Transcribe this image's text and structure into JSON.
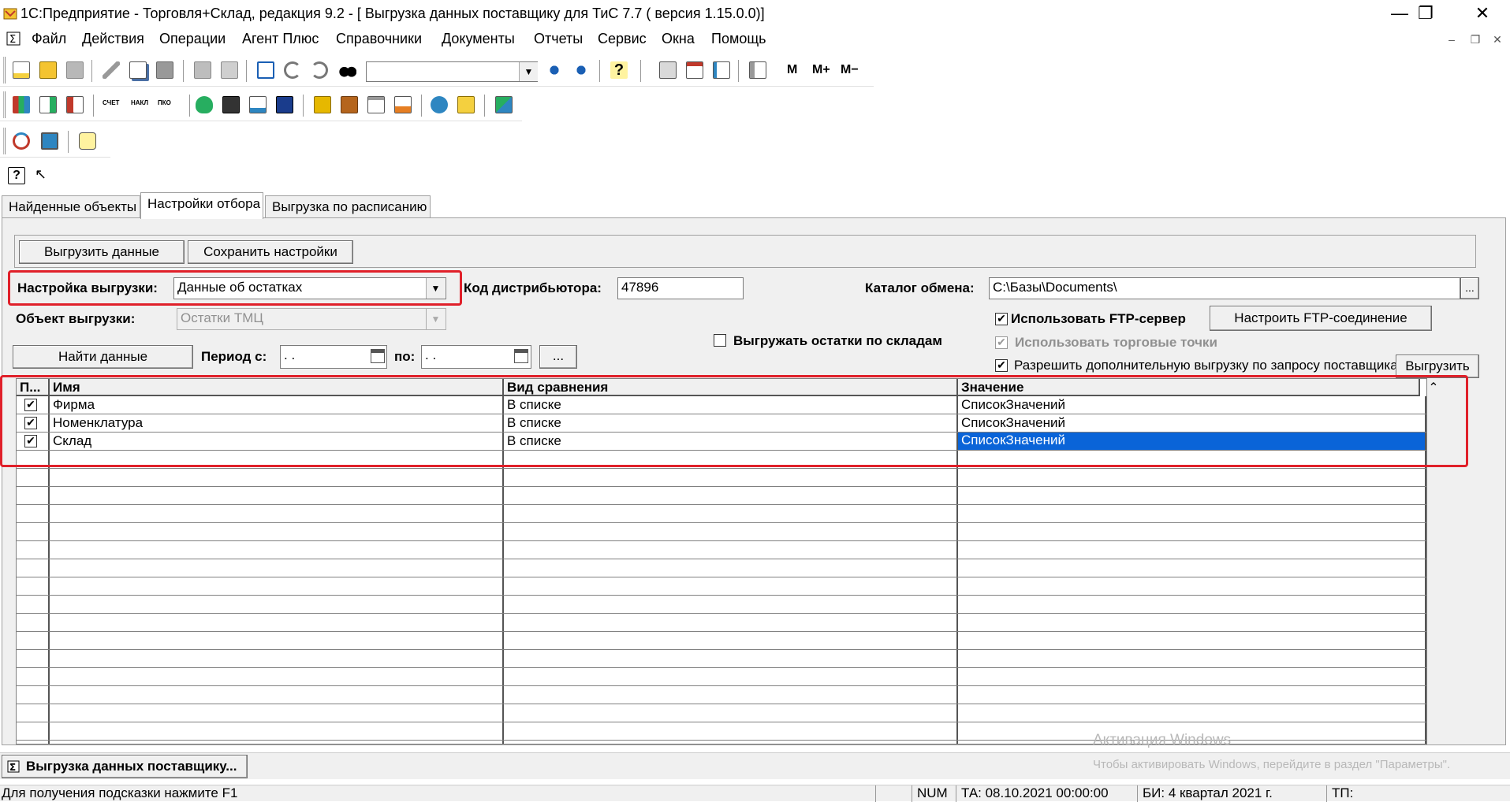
{
  "window": {
    "title": "1С:Предприятие - Торговля+Склад, редакция 9.2 - [ Выгрузка данных поставщику для ТиС 7.7 ( версия 1.15.0.0)]",
    "minimize_glyph": "—",
    "restore_glyph": "❐",
    "close_glyph": "✕"
  },
  "menu": {
    "items": [
      "Файл",
      "Действия",
      "Операции",
      "Агент Плюс",
      "Справочники",
      "Документы",
      "Отчеты",
      "Сервис",
      "Окна",
      "Помощь"
    ],
    "mdi_min": "–",
    "mdi_restore": "❐",
    "mdi_close": "✕"
  },
  "toolbar1": {
    "search_value": "",
    "memory_buttons": [
      "M",
      "M+",
      "M−"
    ]
  },
  "toolbar2": {
    "doc_labels": [
      "СЧЕТ",
      "НАКЛ",
      "ПКО"
    ]
  },
  "tabs": [
    {
      "label": "Найденные объекты"
    },
    {
      "label": "Настройки отбора"
    },
    {
      "label": "Выгрузка по расписанию"
    }
  ],
  "actions": {
    "export_data": "Выгрузить данные",
    "save_settings": "Сохранить настройки"
  },
  "form": {
    "export_setting_label": "Настройка выгрузки:",
    "export_setting_value": "Данные об остатках",
    "distributor_code_label": "Код дистрибьютора:",
    "distributor_code_value": "47896",
    "exchange_dir_label": "Каталог обмена:",
    "exchange_dir_value": "C:\\Базы\\Documents\\",
    "exchange_dir_btn": "...",
    "export_object_label": "Объект выгрузки:",
    "export_object_value": "Остатки ТМЦ",
    "use_ftp_label": "Использовать FTP-сервер",
    "use_ftp_checked": true,
    "configure_ftp": "Настроить FTP-соединение",
    "export_by_warehouse_label": "Выгружать остатки по складам",
    "export_by_warehouse_checked": false,
    "use_trade_points_label": "Использовать торговые точки",
    "use_trade_points_checked": true,
    "allow_extra_label": "Разрешить дополнительную выгрузку по запросу поставщика",
    "allow_extra_checked": true,
    "export_btn": "Выгрузить",
    "find_data": "Найти данные",
    "period_from_label": "Период с:",
    "period_from_value": " .  .",
    "period_to_label": "по:",
    "period_to_value": " .  .",
    "period_btn": "..."
  },
  "grid": {
    "columns": [
      "П...",
      "Имя",
      "Вид сравнения",
      "Значение"
    ],
    "rows": [
      {
        "checked": true,
        "name": "Фирма",
        "comparison": "В списке",
        "value": "СписокЗначений"
      },
      {
        "checked": true,
        "name": "Номенклатура",
        "comparison": "В списке",
        "value": "СписокЗначений"
      },
      {
        "checked": true,
        "name": "Склад",
        "comparison": "В списке",
        "value": "СписокЗначений"
      }
    ],
    "selected_row": 2,
    "scroll_up_glyph": "⌃"
  },
  "taskbar": {
    "window_button": "Выгрузка данных поставщику..."
  },
  "watermark": {
    "line1": "Активация Windows",
    "line2": "Чтобы активировать Windows, перейдите в раздел \"Параметры\"."
  },
  "statusbar": {
    "hint": "Для получения подсказки нажмите F1",
    "num": "NUM",
    "ta": "ТА: 08.10.2021  00:00:00",
    "bi": "БИ: 4 квартал 2021 г.",
    "tp": "ТП:"
  },
  "colors": {
    "highlight": "#e0202a",
    "selection": "#0a64d8"
  }
}
